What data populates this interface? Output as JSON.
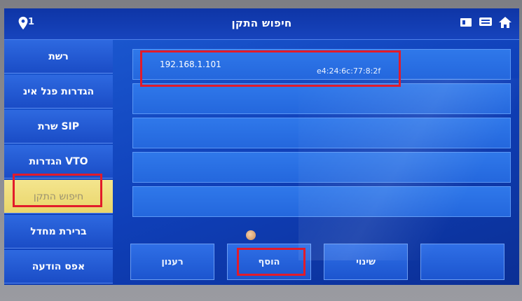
{
  "header": {
    "title": "חיפוש התקן",
    "location_count": "1",
    "icons": [
      "location-pin-icon",
      "card-icon",
      "monitor-icon",
      "home-icon"
    ]
  },
  "sidebar": {
    "items": [
      {
        "label": "רשת"
      },
      {
        "label": "הגדרות פנל אינ"
      },
      {
        "label": "שרת SIP"
      },
      {
        "label": "הגדרות VTO"
      },
      {
        "label": "חיפוש התקן"
      },
      {
        "label": "ברירת מחדל"
      },
      {
        "label": "אפס הודעה"
      }
    ],
    "active_index": 4
  },
  "device_list": {
    "rows": [
      {
        "ip": "192.168.1.101",
        "mac": "e4:24:6c:77:8:2f"
      },
      {
        "ip": "",
        "mac": ""
      },
      {
        "ip": "",
        "mac": ""
      },
      {
        "ip": "",
        "mac": ""
      },
      {
        "ip": "",
        "mac": ""
      }
    ]
  },
  "buttons": {
    "refresh": "רענון",
    "add": "הוסף",
    "edit": "שינוי",
    "extra": ""
  },
  "colors": {
    "screen_blue": "#1e5fd6",
    "active_tab": "#f4e58e",
    "highlight_red": "#e21b2a"
  }
}
